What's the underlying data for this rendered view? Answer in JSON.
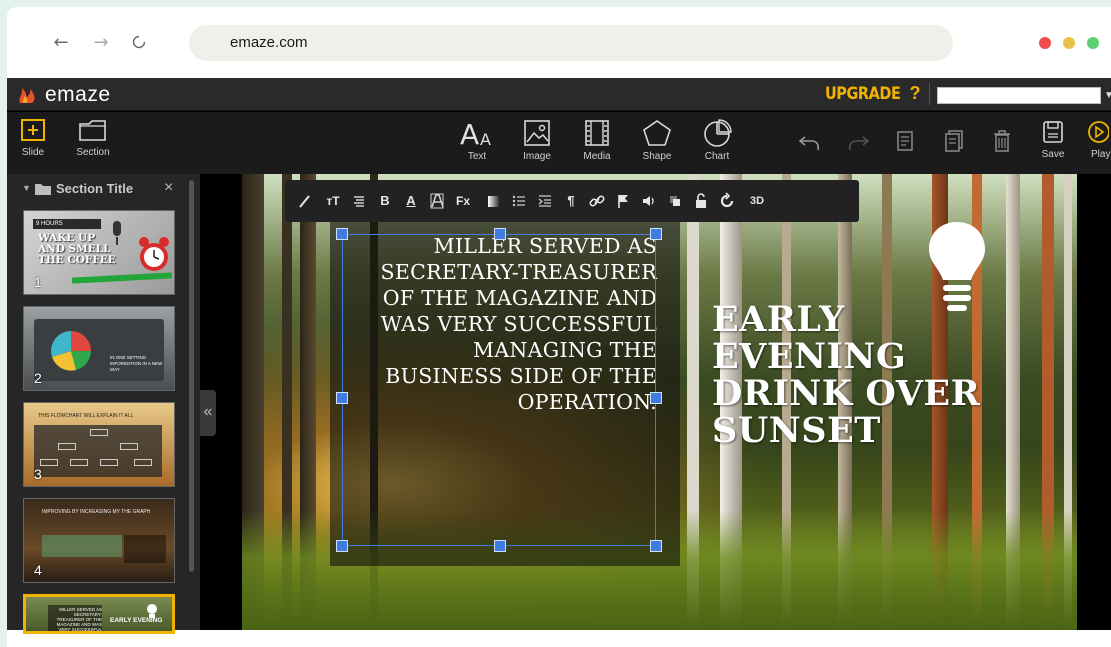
{
  "browser": {
    "url": "emaze.com",
    "dot_colors": [
      "#ee4e4e",
      "#e7c24a",
      "#5ccf75"
    ]
  },
  "topbar": {
    "logo": "emaze",
    "upgrade": "UPGRADE",
    "help": "?",
    "title_value": "",
    "accent": "#f0b400"
  },
  "toolbar": {
    "slide": "Slide",
    "section": "Section",
    "text": "Text",
    "image": "Image",
    "media": "Media",
    "shape": "Shape",
    "chart": "Chart",
    "save": "Save",
    "play": "Play"
  },
  "format_bar": {
    "bold": "B",
    "three_d": "3D"
  },
  "panel": {
    "title": "Section Title",
    "close": "×",
    "collapse": "«",
    "thumbnails": [
      {
        "num": "1",
        "label_top": "9 HOURS",
        "headline": "WAKE UP AND SMELL THE COFFEE"
      },
      {
        "num": "2",
        "caption": "IN ONE SETTING INFORMATION IN A NEW WAY"
      },
      {
        "num": "3",
        "caption": "THIS FLOWCHART WILL EXPLAIN IT ALL"
      },
      {
        "num": "4",
        "caption": "IMPROVING BY INCREASING MY THE GRAPH"
      },
      {
        "num": "5",
        "caption": "MILLER SERVED AS SECRETARY-TREASURER OF THE MAGAZINE AND WAS VERY SUCCESSFUL",
        "headline": "EARLY EVENING"
      }
    ]
  },
  "slide": {
    "quote": "Miller served as secretary-treasurer of the magazine and was very successful managing the business side of the operation.",
    "headline_lines": [
      "EARLY",
      "EVENING",
      "DRINK OVER",
      "SUNSET"
    ],
    "selection_color": "#3f7be0"
  }
}
